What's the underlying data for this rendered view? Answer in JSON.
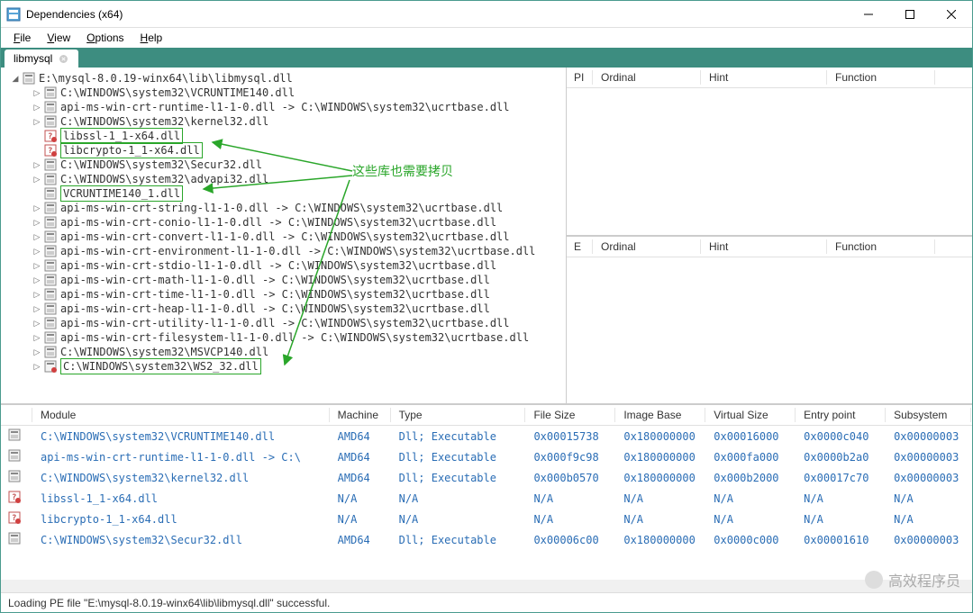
{
  "title": "Dependencies (x64)",
  "menu": {
    "file": "File",
    "view": "View",
    "options": "Options",
    "help": "Help"
  },
  "tab": {
    "label": "libmysql"
  },
  "annot": "这些库也需要拷贝",
  "tree": [
    {
      "depth": 0,
      "exp": "◢",
      "ico": "pe",
      "label": "E:\\mysql-8.0.19-winx64\\lib\\libmysql.dll"
    },
    {
      "depth": 1,
      "exp": "▷",
      "ico": "pe",
      "label": "C:\\WINDOWS\\system32\\VCRUNTIME140.dll"
    },
    {
      "depth": 1,
      "exp": "▷",
      "ico": "pe",
      "label": "api-ms-win-crt-runtime-l1-1-0.dll -> C:\\WINDOWS\\system32\\ucrtbase.dll"
    },
    {
      "depth": 1,
      "exp": "▷",
      "ico": "pe",
      "label": "C:\\WINDOWS\\system32\\kernel32.dll"
    },
    {
      "depth": 1,
      "exp": "",
      "ico": "err",
      "label": "libssl-1_1-x64.dll",
      "hl": true,
      "box": "top"
    },
    {
      "depth": 1,
      "exp": "",
      "ico": "err",
      "label": "libcrypto-1_1-x64.dll",
      "hl": true,
      "box": "bot"
    },
    {
      "depth": 1,
      "exp": "▷",
      "ico": "pe",
      "label": "C:\\WINDOWS\\system32\\Secur32.dll"
    },
    {
      "depth": 1,
      "exp": "▷",
      "ico": "pe",
      "label": "C:\\WINDOWS\\system32\\advapi32.dll"
    },
    {
      "depth": 1,
      "exp": "",
      "ico": "pe",
      "label": "VCRUNTIME140_1.dll",
      "hl": true,
      "box": "solo"
    },
    {
      "depth": 1,
      "exp": "▷",
      "ico": "pe",
      "label": "api-ms-win-crt-string-l1-1-0.dll -> C:\\WINDOWS\\system32\\ucrtbase.dll"
    },
    {
      "depth": 1,
      "exp": "▷",
      "ico": "pe",
      "label": "api-ms-win-crt-conio-l1-1-0.dll -> C:\\WINDOWS\\system32\\ucrtbase.dll"
    },
    {
      "depth": 1,
      "exp": "▷",
      "ico": "pe",
      "label": "api-ms-win-crt-convert-l1-1-0.dll -> C:\\WINDOWS\\system32\\ucrtbase.dll"
    },
    {
      "depth": 1,
      "exp": "▷",
      "ico": "pe",
      "label": "api-ms-win-crt-environment-l1-1-0.dll -> C:\\WINDOWS\\system32\\ucrtbase.dll"
    },
    {
      "depth": 1,
      "exp": "▷",
      "ico": "pe",
      "label": "api-ms-win-crt-stdio-l1-1-0.dll -> C:\\WINDOWS\\system32\\ucrtbase.dll"
    },
    {
      "depth": 1,
      "exp": "▷",
      "ico": "pe",
      "label": "api-ms-win-crt-math-l1-1-0.dll -> C:\\WINDOWS\\system32\\ucrtbase.dll"
    },
    {
      "depth": 1,
      "exp": "▷",
      "ico": "pe",
      "label": "api-ms-win-crt-time-l1-1-0.dll -> C:\\WINDOWS\\system32\\ucrtbase.dll"
    },
    {
      "depth": 1,
      "exp": "▷",
      "ico": "pe",
      "label": "api-ms-win-crt-heap-l1-1-0.dll -> C:\\WINDOWS\\system32\\ucrtbase.dll"
    },
    {
      "depth": 1,
      "exp": "▷",
      "ico": "pe",
      "label": "api-ms-win-crt-utility-l1-1-0.dll -> C:\\WINDOWS\\system32\\ucrtbase.dll"
    },
    {
      "depth": 1,
      "exp": "▷",
      "ico": "pe",
      "label": "api-ms-win-crt-filesystem-l1-1-0.dll -> C:\\WINDOWS\\system32\\ucrtbase.dll"
    },
    {
      "depth": 1,
      "exp": "▷",
      "ico": "pe",
      "label": "C:\\WINDOWS\\system32\\MSVCP140.dll"
    },
    {
      "depth": 1,
      "exp": "▷",
      "ico": "pec",
      "label": "C:\\WINDOWS\\system32\\WS2_32.dll",
      "hl": true,
      "box": "solo"
    }
  ],
  "ie_header": {
    "pi": "PI",
    "ord": "Ordinal",
    "hint": "Hint",
    "func": "Function",
    "e": "E"
  },
  "mod_header": {
    "m1": "Module",
    "m2": "Machine",
    "m3": "Type",
    "m4": "File Size",
    "m5": "Image Base",
    "m6": "Virtual Size",
    "m7": "Entry point",
    "m8": "Subsystem"
  },
  "modules": [
    {
      "ico": "pe",
      "m1": "C:\\WINDOWS\\system32\\VCRUNTIME140.dll",
      "m2": "AMD64",
      "m3": "Dll; Executable",
      "m4": "0x00015738",
      "m5": "0x180000000",
      "m6": "0x00016000",
      "m7": "0x0000c040",
      "m8": "0x00000003"
    },
    {
      "ico": "pe",
      "m1": "api-ms-win-crt-runtime-l1-1-0.dll -> C:\\",
      "m2": "AMD64",
      "m3": "Dll; Executable",
      "m4": "0x000f9c98",
      "m5": "0x180000000",
      "m6": "0x000fa000",
      "m7": "0x0000b2a0",
      "m8": "0x00000003"
    },
    {
      "ico": "pe",
      "m1": "C:\\WINDOWS\\system32\\kernel32.dll",
      "m2": "AMD64",
      "m3": "Dll; Executable",
      "m4": "0x000b0570",
      "m5": "0x180000000",
      "m6": "0x000b2000",
      "m7": "0x00017c70",
      "m8": "0x00000003"
    },
    {
      "ico": "err",
      "m1": "libssl-1_1-x64.dll",
      "m2": "N/A",
      "m3": "N/A",
      "m4": "N/A",
      "m5": "N/A",
      "m6": "N/A",
      "m7": "N/A",
      "m8": "N/A"
    },
    {
      "ico": "err",
      "m1": "libcrypto-1_1-x64.dll",
      "m2": "N/A",
      "m3": "N/A",
      "m4": "N/A",
      "m5": "N/A",
      "m6": "N/A",
      "m7": "N/A",
      "m8": "N/A"
    },
    {
      "ico": "pe",
      "m1": "C:\\WINDOWS\\system32\\Secur32.dll",
      "m2": "AMD64",
      "m3": "Dll; Executable",
      "m4": "0x00006c00",
      "m5": "0x180000000",
      "m6": "0x0000c000",
      "m7": "0x00001610",
      "m8": "0x00000003"
    }
  ],
  "status": "Loading PE file \"E:\\mysql-8.0.19-winx64\\lib\\libmysql.dll\" successful.",
  "watermark": "高效程序员"
}
